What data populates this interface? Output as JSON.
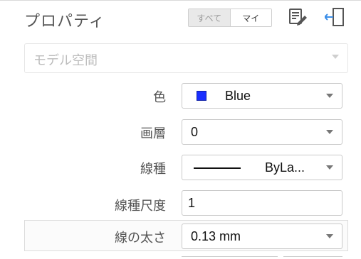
{
  "header": {
    "title": "プロパティ",
    "filter_all": "すべて",
    "filter_my": "マイ",
    "icons": [
      "edit-properties-icon",
      "dock-panel-icon"
    ]
  },
  "space_selector": {
    "label": "モデル空間"
  },
  "properties": [
    {
      "label": "色",
      "value": "Blue",
      "swatch_color": "#1a2fff",
      "type": "dropdown"
    },
    {
      "label": "画層",
      "value": "0",
      "type": "dropdown"
    },
    {
      "label": "線種",
      "value": "ByLa...",
      "type": "dropdown"
    },
    {
      "label": "線種尺度",
      "value": "1",
      "type": "input"
    },
    {
      "label": "線の太さ",
      "value": "0.13 mm",
      "type": "dropdown"
    }
  ]
}
